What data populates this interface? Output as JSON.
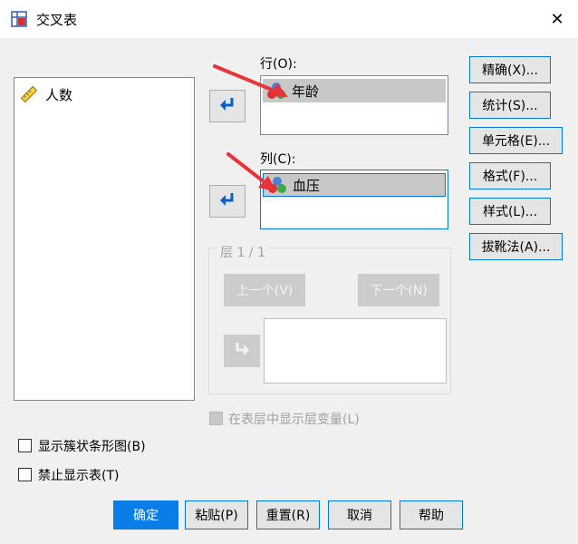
{
  "window": {
    "title": "交叉表",
    "close_glyph": "✕"
  },
  "variables": {
    "items": [
      {
        "label": "人数",
        "icon": "ruler-icon"
      }
    ]
  },
  "rows": {
    "label": "行(O):",
    "items": [
      {
        "label": "年龄",
        "icon": "nominal-icon"
      }
    ]
  },
  "columns": {
    "label": "列(C):",
    "items": [
      {
        "label": "血压",
        "icon": "nominal-icon"
      }
    ]
  },
  "layer": {
    "label": "层 1 / 1",
    "prev_label": "上一个(V)",
    "next_label": "下一个(N)"
  },
  "side_buttons": [
    {
      "label": "精确(X)..."
    },
    {
      "label": "统计(S)..."
    },
    {
      "label": "单元格(E)..."
    },
    {
      "label": "格式(F)..."
    },
    {
      "label": "样式(L)..."
    },
    {
      "label": "拔靴法(A)..."
    }
  ],
  "options": {
    "show_layer_var": "在表层中显示层变量(L)",
    "clustered_bar": "显示簇状条形图(B)",
    "suppress_tables": "禁止显示表(T)"
  },
  "bottom_buttons": [
    {
      "label": "确定"
    },
    {
      "label": "粘贴(P)"
    },
    {
      "label": "重置(R)"
    },
    {
      "label": "取消"
    },
    {
      "label": "帮助"
    }
  ],
  "colors": {
    "accent": "#0078d7",
    "primary": "#0a7ee8",
    "annotation": "#e8333a"
  }
}
